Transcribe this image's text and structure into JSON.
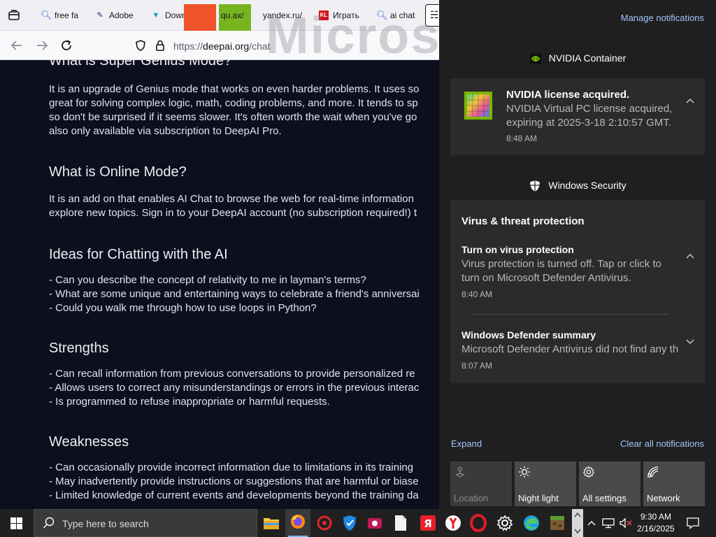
{
  "browser": {
    "tabs": [
      {
        "label": "free fa",
        "icon": "search-icon"
      },
      {
        "label": "Adobe",
        "icon": "adobe-icon"
      },
      {
        "label": "Down",
        "icon": "download-icon"
      },
      {
        "label": "qu.ax/",
        "icon": "link-icon"
      },
      {
        "label": "yandex.ru/",
        "icon": "yandex-icon"
      },
      {
        "label": "Играть",
        "icon": "game-icon"
      },
      {
        "label": "ai chat",
        "icon": "search-icon"
      }
    ],
    "url_prefix": "https://",
    "url_domain": "deepai.org",
    "url_path": "/chat",
    "watermark": "Microso"
  },
  "article": {
    "sections": [
      {
        "heading": "What is Super Genius Mode?",
        "lines": [
          "It is an upgrade of Genius mode that works on even harder problems. It uses so",
          "great for solving complex logic, math, coding problems, and more. It tends to sp",
          "so don't be surprised if it seems slower. It's often worth the wait when you've go",
          "also only available via subscription to DeepAI Pro."
        ]
      },
      {
        "heading": "What is Online Mode?",
        "lines": [
          "It is an add on that enables AI Chat to browse the web for real-time information",
          "explore new topics. Sign in to your DeepAI account (no subscription required!) t"
        ]
      },
      {
        "heading": "Ideas for Chatting with the AI",
        "lines": [
          "- Can you describe the concept of relativity to me in layman's terms?",
          "- What are some unique and entertaining ways to celebrate a friend's anniversai",
          "- Could you walk me through how to use loops in Python?"
        ]
      },
      {
        "heading": "Strengths",
        "lines": [
          "- Can recall information from previous conversations to provide personalized re",
          "- Allows users to correct any misunderstandings or errors in the previous interac",
          "- Is programmed to refuse inappropriate or harmful requests."
        ]
      },
      {
        "heading": "Weaknesses",
        "lines": [
          "- Can occasionally provide incorrect information due to limitations in its training",
          "- May inadvertently provide instructions or suggestions that are harmful or biase",
          "- Limited knowledge of current events and developments beyond the training da"
        ]
      }
    ]
  },
  "action_center": {
    "manage_label": "Manage notifications",
    "nvidia": {
      "app": "NVIDIA Container",
      "title": "NVIDIA license acquired.",
      "body1": "NVIDIA Virtual PC license acquired,",
      "body2": "expiring at 2025-3-18 2:10:57 GMT.",
      "time": "8:48 AM"
    },
    "security": {
      "app": "Windows Security",
      "category": "Virus & threat protection",
      "n1_title": "Turn on virus protection",
      "n1_body1": "Virus protection is turned off. Tap or click to",
      "n1_body2": "turn on Microsoft Defender Antivirus.",
      "n1_time": "8:40 AM",
      "n2_title": "Windows Defender summary",
      "n2_body": "Microsoft Defender Antivirus did not find any th",
      "n2_time": "8:07 AM"
    },
    "expand_label": "Expand",
    "clear_label": "Clear all notifications",
    "quick_actions": [
      {
        "label": "Location",
        "icon": "location-icon",
        "state": "off"
      },
      {
        "label": "Night light",
        "icon": "night-light-icon",
        "state": "on"
      },
      {
        "label": "All settings",
        "icon": "gear-icon",
        "state": "on"
      },
      {
        "label": "Network",
        "icon": "network-icon",
        "state": "on"
      }
    ]
  },
  "taskbar": {
    "search_placeholder": "Type here to search",
    "time": "9:30 AM",
    "date": "2/16/2025",
    "apps": [
      "file-explorer-icon",
      "firefox-icon",
      "app-red-icon",
      "shield-app-icon",
      "recorder-icon",
      "document-icon",
      "yandex-browser-icon",
      "yandex-icon",
      "opera-icon",
      "settings-icon",
      "edge-icon",
      "minecraft-icon"
    ]
  }
}
